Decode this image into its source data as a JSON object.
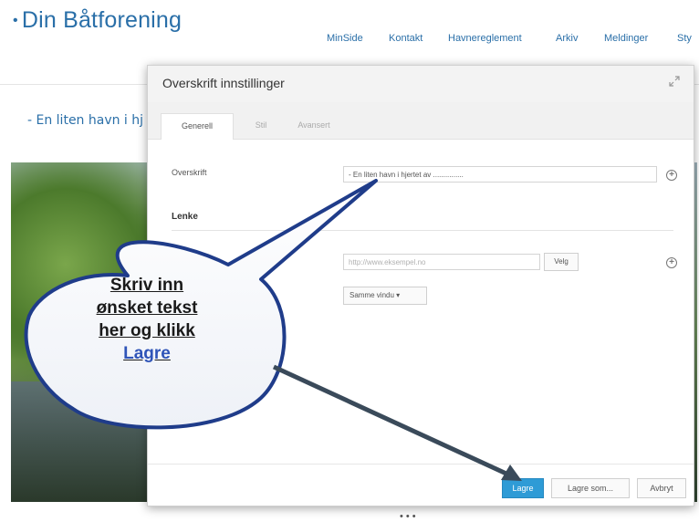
{
  "site": {
    "title": "Din Båtforening",
    "title_prefix": "•",
    "nav": [
      "MinSide",
      "Kontakt",
      "Havnereglement",
      "Arkiv",
      "Meldinger",
      "Sty"
    ],
    "tagline": "- En liten havn i hj"
  },
  "modal": {
    "title": "Overskrift innstillinger",
    "expand_icon": "expand-icon",
    "tabs": [
      {
        "label": "Generell",
        "active": true
      },
      {
        "label": "Stil",
        "active": false
      },
      {
        "label": "Avansert",
        "active": false
      }
    ],
    "fields": {
      "overskrift_label": "Overskrift",
      "overskrift_value": "- En liten havn i hjertet av ...............",
      "lenke_label": "Lenke",
      "url_placeholder": "http://www.eksempel.no",
      "velg_label": "Velg",
      "target_value": "Samme vindu ▾"
    },
    "buttons": {
      "save": "Lagre",
      "save_as": "Lagre som...",
      "cancel": "Avbryt"
    }
  },
  "callout": {
    "lines": [
      "Skriv inn",
      "ønsket tekst",
      "her og klikk"
    ],
    "link": "Lagre"
  },
  "carousel_dots": "•••",
  "colors": {
    "brand": "#2a6fa8",
    "primary_button": "#2e9bd6",
    "callout_border": "#1f3c8a",
    "arrow": "#3a4a5a"
  }
}
